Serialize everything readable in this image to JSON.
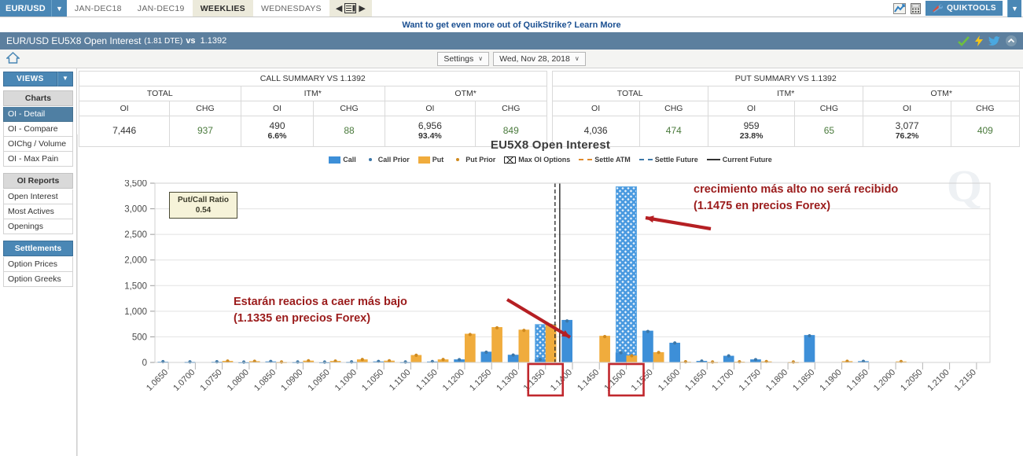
{
  "topbar": {
    "symbol": "EUR/USD",
    "symbol_caret": "▼",
    "tabs": [
      {
        "label": "JAN-DEC18",
        "active": false
      },
      {
        "label": "JAN-DEC19",
        "active": false
      },
      {
        "label": "WEEKLIES",
        "active": true
      },
      {
        "label": "WEDNESDAYS",
        "active": false
      }
    ],
    "pager_prev": "◀",
    "pager_next": "▶",
    "quiktools_label": "QUIKTOOLS",
    "quiktools_caret": "▼"
  },
  "promo": {
    "text": "Want to get even more out of QuikStrike? Learn More"
  },
  "titlebar": {
    "title": "EUR/USD EU5X8 Open Interest",
    "dte": "(1.81 DTE)",
    "vs": "vs",
    "price": "1.1392"
  },
  "toolbar": {
    "settings_label": "Settings",
    "date_label": "Wed, Nov 28, 2018",
    "caret": "∨"
  },
  "sidebar": {
    "views_label": "VIEWS",
    "views_caret": "▼",
    "groups": [
      {
        "header": "Charts",
        "style": "grey",
        "items": [
          {
            "label": "OI - Detail",
            "selected": true
          },
          {
            "label": "OI - Compare",
            "selected": false
          },
          {
            "label": "OIChg / Volume",
            "selected": false
          },
          {
            "label": "OI - Max Pain",
            "selected": false
          }
        ]
      },
      {
        "header": "OI Reports",
        "style": "grey",
        "items": [
          {
            "label": "Open Interest",
            "selected": false
          },
          {
            "label": "Most Actives",
            "selected": false
          },
          {
            "label": "Openings",
            "selected": false
          }
        ]
      },
      {
        "header": "Settlements",
        "style": "blue",
        "items": [
          {
            "label": "Option Prices",
            "selected": false
          },
          {
            "label": "Option Greeks",
            "selected": false
          }
        ]
      }
    ]
  },
  "summaries": [
    {
      "caption": "CALL SUMMARY VS 1.1392",
      "groups": [
        "TOTAL",
        "ITM*",
        "OTM*"
      ],
      "subheaders": [
        "OI",
        "CHG",
        "OI",
        "CHG",
        "OI",
        "CHG"
      ],
      "values": [
        {
          "main": "7,446",
          "pct": "",
          "chg": false
        },
        {
          "main": "937",
          "pct": "",
          "chg": true
        },
        {
          "main": "490",
          "pct": "6.6%",
          "chg": false
        },
        {
          "main": "88",
          "pct": "",
          "chg": true
        },
        {
          "main": "6,956",
          "pct": "93.4%",
          "chg": false
        },
        {
          "main": "849",
          "pct": "",
          "chg": true
        }
      ]
    },
    {
      "caption": "PUT SUMMARY VS 1.1392",
      "groups": [
        "TOTAL",
        "ITM*",
        "OTM*"
      ],
      "subheaders": [
        "OI",
        "CHG",
        "OI",
        "CHG",
        "OI",
        "CHG"
      ],
      "values": [
        {
          "main": "4,036",
          "pct": "",
          "chg": false
        },
        {
          "main": "474",
          "pct": "",
          "chg": true
        },
        {
          "main": "959",
          "pct": "23.8%",
          "chg": false
        },
        {
          "main": "65",
          "pct": "",
          "chg": true
        },
        {
          "main": "3,077",
          "pct": "76.2%",
          "chg": false
        },
        {
          "main": "409",
          "pct": "",
          "chg": true
        }
      ]
    }
  ],
  "chart": {
    "title": "EU5X8 Open Interest",
    "legend": [
      {
        "label": "Call",
        "marker": "swatch-call"
      },
      {
        "label": "Call Prior",
        "marker": "dot-call"
      },
      {
        "label": "Put",
        "marker": "swatch-put"
      },
      {
        "label": "Put Prior",
        "marker": "dot-put"
      },
      {
        "label": "Max OI Options",
        "marker": "hatch-box"
      },
      {
        "label": "Settle ATM",
        "marker": "dash-orange"
      },
      {
        "label": "Settle Future",
        "marker": "dash-blue"
      },
      {
        "label": "Current Future",
        "marker": "solid-black"
      }
    ],
    "putcall_ratio_label": "Put/Call Ratio",
    "putcall_ratio_value": "0.54",
    "annotations": [
      {
        "line1": "Estarán reacios a caer más bajo",
        "line2": "(1.1335 en precios Forex)"
      },
      {
        "line1": "crecimiento más alto no será recibido",
        "line2": "(1.1475 en precios Forex)"
      }
    ],
    "highlighted_strikes": [
      "1.1350",
      "1.1500"
    ],
    "colors": {
      "call": "#3d8fd8",
      "put": "#f0ac3d",
      "annotation": "#9b1c1c",
      "accent": "#4a87b5",
      "title_bar": "#5c7f9e"
    }
  },
  "chart_data": {
    "type": "bar",
    "title": "EU5X8 Open Interest",
    "xlabel": "",
    "ylabel": "",
    "ylim": [
      0,
      3500
    ],
    "yticks": [
      "0",
      "500",
      "1,000",
      "1,500",
      "2,000",
      "2,500",
      "3,000",
      "3,500"
    ],
    "grid": true,
    "legend_position": "top",
    "categories": [
      "1.0650",
      "1.0700",
      "1.0750",
      "1.0800",
      "1.0850",
      "1.0900",
      "1.0950",
      "1.1000",
      "1.1050",
      "1.1100",
      "1.1150",
      "1.1200",
      "1.1250",
      "1.1300",
      "1.1350",
      "1.1400",
      "1.1450",
      "1.1500",
      "1.1550",
      "1.1600",
      "1.1650",
      "1.1700",
      "1.1750",
      "1.1800",
      "1.1850",
      "1.1900",
      "1.1950",
      "1.2000",
      "1.2050",
      "1.2100",
      "1.2150"
    ],
    "series": [
      {
        "name": "Call",
        "color": "#3d8fd8",
        "values": [
          15,
          12,
          14,
          8,
          20,
          10,
          8,
          12,
          20,
          10,
          18,
          60,
          210,
          150,
          65,
          830,
          0,
          195,
          620,
          385,
          30,
          130,
          60,
          0,
          535,
          0,
          25,
          0,
          0,
          0,
          0
        ]
      },
      {
        "name": "Put",
        "color": "#f0ac3d",
        "values": [
          0,
          0,
          30,
          25,
          10,
          35,
          30,
          60,
          35,
          145,
          60,
          560,
          690,
          640,
          740,
          0,
          520,
          135,
          200,
          15,
          10,
          15,
          20,
          10,
          0,
          25,
          0,
          20,
          0,
          0,
          0
        ]
      },
      {
        "name": "Call Prior",
        "color": "#3c77a8",
        "type": "marker",
        "values": [
          15,
          12,
          14,
          8,
          20,
          10,
          8,
          12,
          20,
          10,
          18,
          55,
          200,
          145,
          60,
          810,
          0,
          190,
          605,
          380,
          28,
          128,
          55,
          0,
          520,
          0,
          22,
          0,
          0,
          0,
          0
        ]
      },
      {
        "name": "Put Prior",
        "color": "#d08a1e",
        "type": "marker",
        "values": [
          0,
          0,
          28,
          24,
          10,
          33,
          28,
          58,
          33,
          140,
          58,
          545,
          675,
          625,
          725,
          0,
          505,
          130,
          195,
          14,
          10,
          14,
          18,
          10,
          0,
          24,
          0,
          18,
          0,
          0,
          0
        ]
      },
      {
        "name": "Max OI Options",
        "color": "#3d8fd8",
        "type": "hatch",
        "values": [
          0,
          0,
          0,
          0,
          0,
          0,
          0,
          0,
          0,
          0,
          0,
          0,
          0,
          0,
          740,
          0,
          0,
          3430,
          0,
          0,
          0,
          0,
          0,
          0,
          0,
          0,
          0,
          0,
          0,
          0,
          0
        ]
      }
    ],
    "reference_lines": [
      {
        "name": "Settle Future",
        "value": "1.1392",
        "style": "dashed",
        "color": "#222222"
      },
      {
        "name": "Current Future",
        "value": "1.1400",
        "style": "solid",
        "color": "#111111"
      }
    ]
  }
}
